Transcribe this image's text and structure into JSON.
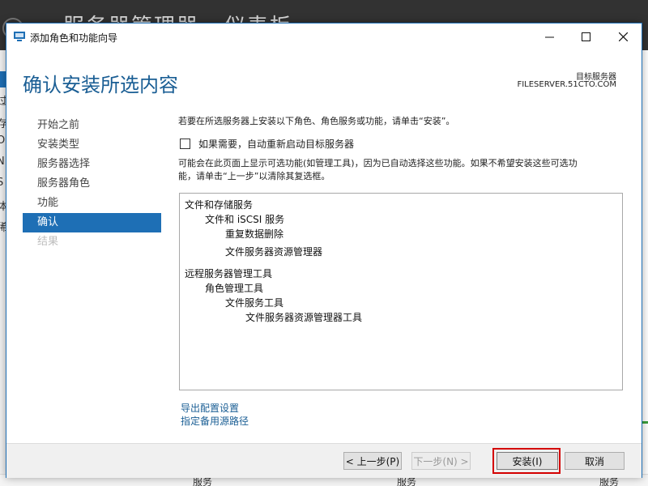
{
  "background": {
    "title": "服务器管理器 · 仪表板",
    "side_chars": [
      "表",
      "过",
      "存",
      "O",
      "N",
      "S",
      "体",
      "稀"
    ],
    "tile_labels": [
      "服务",
      "服务",
      "服务"
    ]
  },
  "window": {
    "title": "添加角色和功能向导",
    "controls": {
      "minimize": "—",
      "maximize": "☐",
      "close": "✕"
    }
  },
  "header": {
    "page_title": "确认安装所选内容",
    "target_label": "目标服务器",
    "target_server": "FILESERVER.51CTO.COM"
  },
  "nav": {
    "items": [
      {
        "label": "开始之前",
        "state": "normal"
      },
      {
        "label": "安装类型",
        "state": "normal"
      },
      {
        "label": "服务器选择",
        "state": "normal"
      },
      {
        "label": "服务器角色",
        "state": "normal"
      },
      {
        "label": "功能",
        "state": "normal"
      },
      {
        "label": "确认",
        "state": "active"
      },
      {
        "label": "结果",
        "state": "disabled"
      }
    ]
  },
  "content": {
    "intro": "若要在所选服务器上安装以下角色、角色服务或功能，请单击“安装”。",
    "restart_checkbox": {
      "label": "如果需要，自动重新启动目标服务器",
      "checked": false
    },
    "note_line1": "可能会在此页面上显示可选功能(如管理工具)，因为已自动选择这些功能。如果不希望安装这些可选功",
    "note_line2": "能，请单击“上一步”以清除其复选框。",
    "features": [
      {
        "label": "文件和存储服务",
        "level": 0
      },
      {
        "label": "文件和 iSCSI 服务",
        "level": 1
      },
      {
        "label": "重复数据删除",
        "level": 2
      },
      {
        "label": "文件服务器资源管理器",
        "level": 2
      },
      {
        "label": "远程服务器管理工具",
        "level": 0
      },
      {
        "label": "角色管理工具",
        "level": 1
      },
      {
        "label": "文件服务工具",
        "level": 2
      },
      {
        "label": "文件服务器资源管理器工具",
        "level": 3
      }
    ],
    "links": {
      "export": "导出配置设置",
      "alternate_source": "指定备用源路径"
    }
  },
  "footer": {
    "prev": "< 上一步(P)",
    "next": "下一步(N) >",
    "install": "安装(I)",
    "cancel": "取消"
  },
  "colors": {
    "accent": "#1e6fb5",
    "title": "#1a5e94",
    "highlight": "#d40000"
  }
}
